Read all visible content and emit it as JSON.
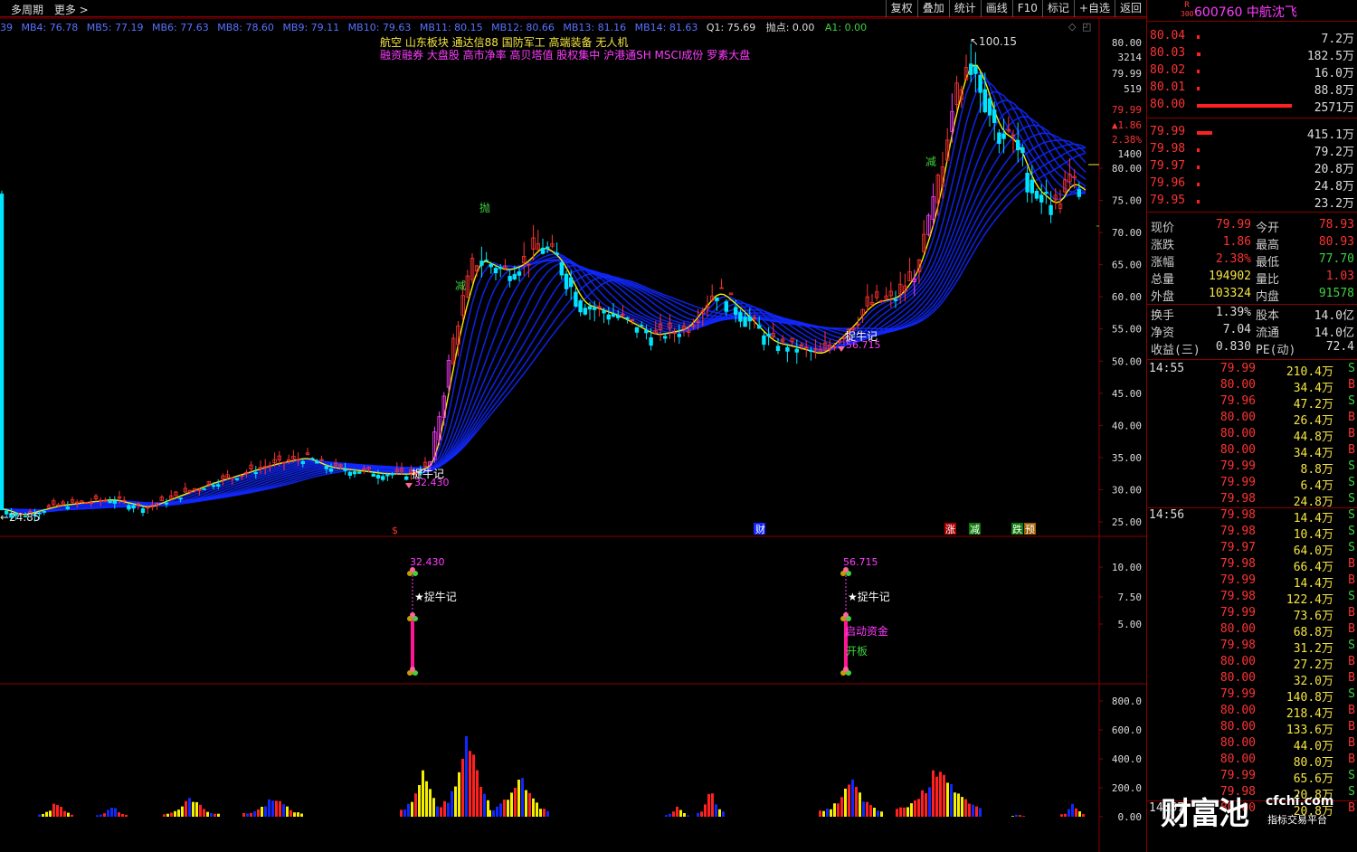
{
  "toolbar": {
    "left": [
      "多周期",
      "更多 >"
    ],
    "buttons": [
      "复权",
      "叠加",
      "统计",
      "画线",
      "F10",
      "标记",
      "+自选",
      "返回"
    ]
  },
  "ma_bar": {
    "items": [
      "39",
      "MB4: 76.78",
      "MB5: 77.19",
      "MB6: 77.63",
      "MB8: 78.60",
      "MB9: 79.11",
      "MB10: 79.63",
      "MB11: 80.15",
      "MB12: 80.66",
      "MB13: 81.16",
      "MB14: 81.63"
    ],
    "q1": "Q1: 75.69",
    "paodian": "抛点: 0.00",
    "a1": "A1: 0.00"
  },
  "concepts": {
    "row1": "航空         山东板块        通达信88 国防军工 高端装备 无人机",
    "row2": "融资融券 大盘股 高市净率 高贝塔值 股权集中 沪港通SH MSCI成份 罗素大盘"
  },
  "main_axis": [
    "80.00",
    "3214",
    "79.99",
    "519",
    "79.99",
    "▲1.86",
    "2.38%",
    "1400",
    "80.00",
    "75.00",
    "70.00",
    "65.00",
    "60.00",
    "55.00",
    "50.00",
    "45.00",
    "40.00",
    "35.00",
    "30.00",
    "25.00"
  ],
  "chart_labels": {
    "high": "100.15",
    "low": "24.85",
    "low_mark1": "32.430",
    "low_mark2": "56.715",
    "zhuoniu": "捉牛记",
    "pao": "抛",
    "jian": "减",
    "cai": "财",
    "zhang": "涨",
    "die": "跌",
    "yu": "预",
    "dollar": "$"
  },
  "mid_axis": [
    "10.00",
    "7.50",
    "5.00"
  ],
  "mid_labels": {
    "val1": "32.430",
    "val2": "56.715",
    "star": "★捉牛记",
    "qidong": "启动资金",
    "kaiban": "开板"
  },
  "vol_axis": [
    "800.0",
    "600.0",
    "400.0",
    "200.0",
    "0.00"
  ],
  "chart_data": {
    "type": "candlestick",
    "high": 100.15,
    "low": 24.85,
    "ylim": [
      22,
      102
    ],
    "vol_ylim": [
      0,
      900
    ]
  },
  "stock": {
    "badge_top": "R",
    "badge_bottom": "300",
    "title": "600760 中航沈飞"
  },
  "orderbook": {
    "asks": [
      {
        "price": "80.04",
        "vol": "7.2万",
        "bar": 0.02
      },
      {
        "price": "80.03",
        "vol": "182.5万",
        "bar": 0.04
      },
      {
        "price": "80.02",
        "vol": "16.0万",
        "bar": 0.02
      },
      {
        "price": "80.01",
        "vol": "88.8万",
        "bar": 0.02
      },
      {
        "price": "80.00",
        "vol": "2571万",
        "bar": 1.0
      }
    ],
    "bids": [
      {
        "price": "79.99",
        "vol": "415.1万",
        "bar": 0.16
      },
      {
        "price": "79.98",
        "vol": "79.2万",
        "bar": 0.02
      },
      {
        "price": "79.97",
        "vol": "20.8万",
        "bar": 0.02
      },
      {
        "price": "79.96",
        "vol": "24.8万",
        "bar": 0.02
      },
      {
        "price": "79.95",
        "vol": "23.2万",
        "bar": 0.02
      }
    ]
  },
  "quote": [
    [
      "现价",
      "79.99",
      "今开",
      "78.93"
    ],
    [
      "涨跌",
      "1.86",
      "最高",
      "80.93"
    ],
    [
      "涨幅",
      "2.38%",
      "最低",
      "77.70"
    ],
    [
      "总量",
      "194902",
      "量比",
      "1.03"
    ],
    [
      "外盘",
      "103324",
      "内盘",
      "91578"
    ]
  ],
  "quote2": [
    [
      "换手",
      "1.39%",
      "股本",
      "14.0亿"
    ],
    [
      "净资",
      "7.04",
      "流通",
      "14.0亿"
    ],
    [
      "收益(三)",
      "0.830",
      "PE(动)",
      "72.4"
    ]
  ],
  "ticks": [
    {
      "t": "14:55",
      "p": "79.99",
      "v": "210.4万",
      "s": "S"
    },
    {
      "t": "",
      "p": "80.00",
      "v": "34.4万",
      "s": "B"
    },
    {
      "t": "",
      "p": "79.96",
      "v": "47.2万",
      "s": "S"
    },
    {
      "t": "",
      "p": "80.00",
      "v": "26.4万",
      "s": "B"
    },
    {
      "t": "",
      "p": "80.00",
      "v": "44.8万",
      "s": "B"
    },
    {
      "t": "",
      "p": "80.00",
      "v": "34.4万",
      "s": "B"
    },
    {
      "t": "",
      "p": "79.99",
      "v": "8.8万",
      "s": "S"
    },
    {
      "t": "",
      "p": "79.99",
      "v": "6.4万",
      "s": "S"
    },
    {
      "t": "",
      "p": "79.98",
      "v": "24.8万",
      "s": "S"
    },
    {
      "t": "14:56",
      "p": "79.98",
      "v": "14.4万",
      "s": "S"
    },
    {
      "t": "",
      "p": "79.98",
      "v": "10.4万",
      "s": "S"
    },
    {
      "t": "",
      "p": "79.97",
      "v": "64.0万",
      "s": "S"
    },
    {
      "t": "",
      "p": "79.98",
      "v": "66.4万",
      "s": "B"
    },
    {
      "t": "",
      "p": "79.99",
      "v": "14.4万",
      "s": "B"
    },
    {
      "t": "",
      "p": "79.98",
      "v": "122.4万",
      "s": "S"
    },
    {
      "t": "",
      "p": "79.99",
      "v": "73.6万",
      "s": "B"
    },
    {
      "t": "",
      "p": "80.00",
      "v": "68.8万",
      "s": "B"
    },
    {
      "t": "",
      "p": "79.98",
      "v": "31.2万",
      "s": "S"
    },
    {
      "t": "",
      "p": "80.00",
      "v": "27.2万",
      "s": "B"
    },
    {
      "t": "",
      "p": "80.00",
      "v": "32.0万",
      "s": "B"
    },
    {
      "t": "",
      "p": "79.99",
      "v": "140.8万",
      "s": "S"
    },
    {
      "t": "",
      "p": "80.00",
      "v": "218.4万",
      "s": "B"
    },
    {
      "t": "",
      "p": "80.00",
      "v": "133.6万",
      "s": "B"
    },
    {
      "t": "",
      "p": "80.00",
      "v": "44.0万",
      "s": "B"
    },
    {
      "t": "",
      "p": "80.00",
      "v": "80.0万",
      "s": "B"
    },
    {
      "t": "",
      "p": "79.99",
      "v": "65.6万",
      "s": "S"
    },
    {
      "t": "",
      "p": "79.98",
      "v": "20.8万",
      "s": "S"
    },
    {
      "t": "14:57",
      "p": "80.00",
      "v": "20.8万",
      "s": "B"
    }
  ],
  "watermark": {
    "big": "财富池",
    "url": "cfchi.com",
    "sub": "指标交易平台"
  },
  "colors": {
    "up": "#ff3333",
    "down": "#00e5ff",
    "ribbon": "#1028ff",
    "ma": "#f5f000",
    "magenta": "#ff3cff",
    "grid": "#8b0000"
  }
}
